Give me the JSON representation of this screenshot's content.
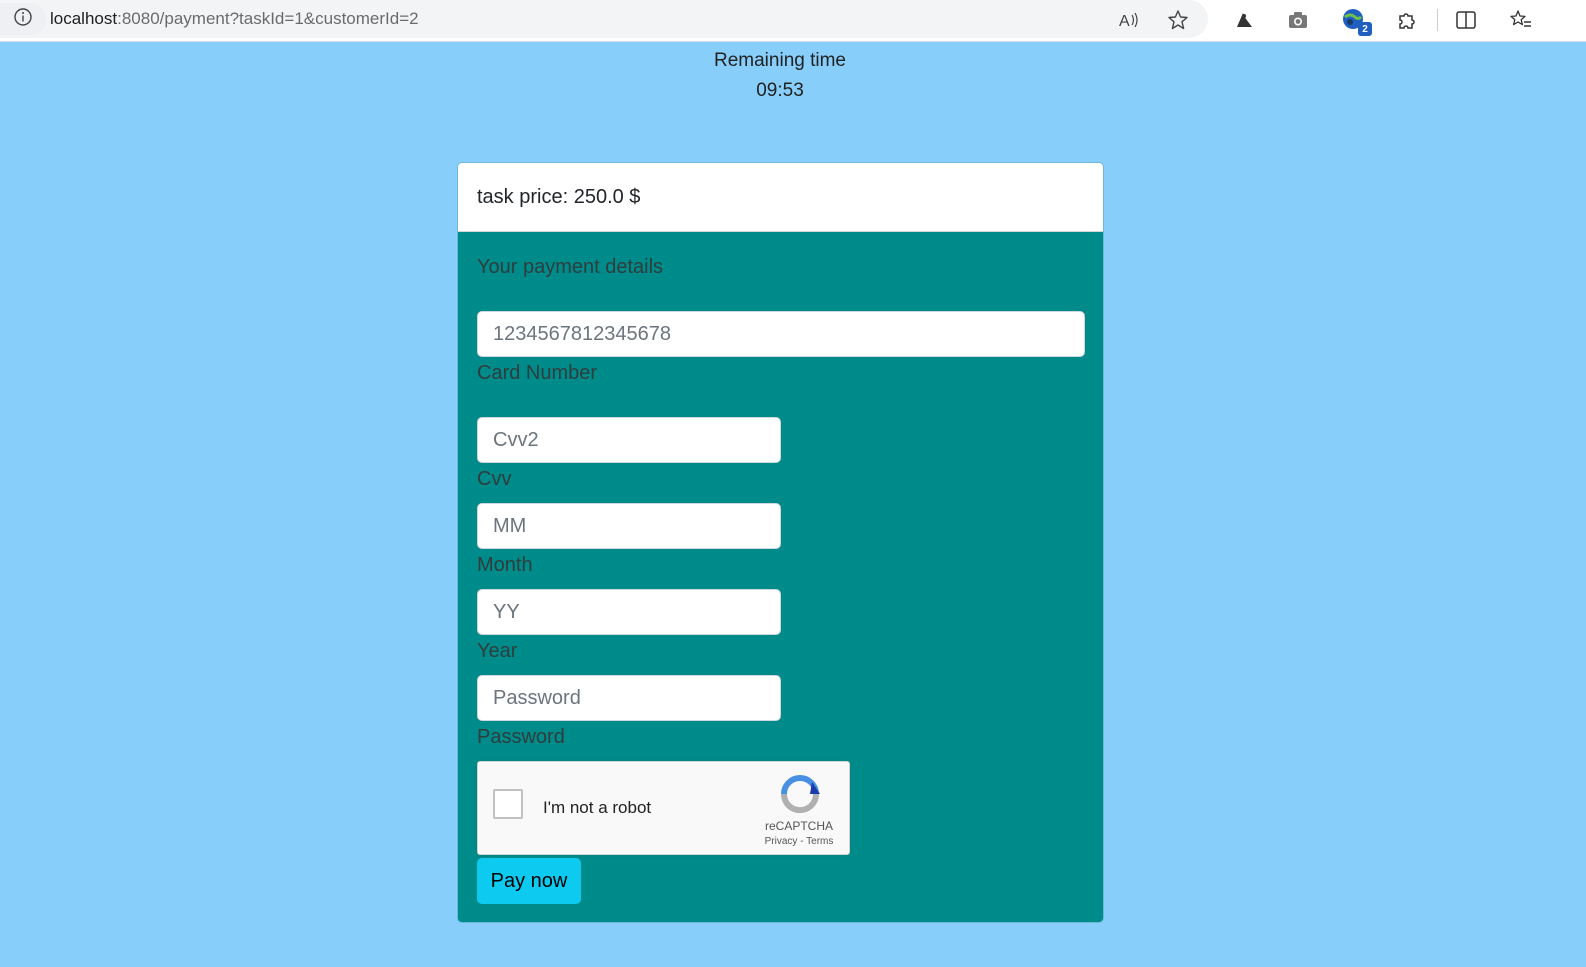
{
  "browser": {
    "url_host": "localhost",
    "url_rest": ":8080/payment?taskId=1&customerId=2",
    "extension_badge": "2",
    "icons": [
      "info-icon",
      "read-aloud-icon",
      "favorite-star-icon",
      "extension-bird-icon",
      "screenshot-camera-icon",
      "profile-globe-icon",
      "extensions-puzzle-icon",
      "split-screen-icon",
      "favorites-list-icon"
    ]
  },
  "timer": {
    "label": "Remaining time",
    "value": "09:53"
  },
  "card": {
    "header": "task price: 250.0 $",
    "section_title": "Your payment details",
    "fields": [
      {
        "value": "1234567812345678",
        "label": "Card Number"
      },
      {
        "placeholder": "Cvv2",
        "label": "Cvv"
      },
      {
        "placeholder": "MM",
        "label": "Month"
      },
      {
        "placeholder": "YY",
        "label": "Year"
      },
      {
        "placeholder": "Password",
        "label": "Password"
      }
    ],
    "recaptcha": {
      "text": "I'm not a robot",
      "brand": "reCAPTCHA",
      "links": "Privacy - Terms"
    },
    "pay_button": "Pay now"
  }
}
